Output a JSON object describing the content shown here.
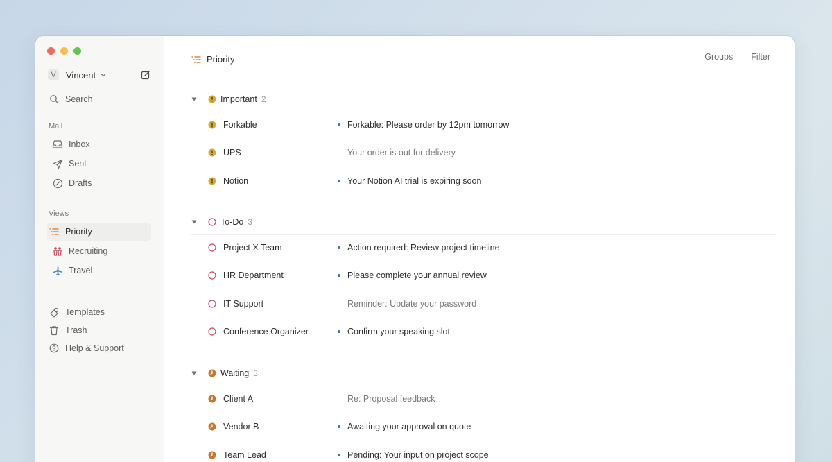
{
  "account": {
    "initial": "V",
    "name": "Vincent"
  },
  "sidebar": {
    "search": "Search",
    "mail_section": "Mail",
    "mail_items": [
      "Inbox",
      "Sent",
      "Drafts"
    ],
    "views_section": "Views",
    "view_items": [
      "Priority",
      "Recruiting",
      "Travel"
    ],
    "bottom_items": [
      "Templates",
      "Trash",
      "Help & Support"
    ]
  },
  "header": {
    "title": "Priority",
    "groups": "Groups",
    "filter": "Filter"
  },
  "groups": [
    {
      "label": "Important",
      "count": "2",
      "icon": "exclamation-icon",
      "color": "#d9a93a",
      "rows": [
        {
          "sender": "Forkable",
          "subject": "Forkable: Please order by 12pm tomorrow",
          "unread": true
        },
        {
          "sender": "UPS",
          "subject": "Your order is out for delivery",
          "unread": false
        },
        {
          "sender": "Notion",
          "subject": "Your Notion AI trial is expiring soon",
          "unread": true
        }
      ]
    },
    {
      "label": "To-Do",
      "count": "3",
      "icon": "circle-icon",
      "color": "#c7485b",
      "rows": [
        {
          "sender": "Project X Team",
          "subject": "Action required: Review project timeline",
          "unread": true
        },
        {
          "sender": "HR Department",
          "subject": "Please complete your annual review",
          "unread": true
        },
        {
          "sender": "IT Support",
          "subject": "Reminder: Update your password",
          "unread": false
        },
        {
          "sender": "Conference Organizer",
          "subject": "Confirm your speaking slot",
          "unread": true
        }
      ]
    },
    {
      "label": "Waiting",
      "count": "3",
      "icon": "clock-icon",
      "color": "#c7762f",
      "rows": [
        {
          "sender": "Client A",
          "subject": "Re: Proposal feedback",
          "unread": false
        },
        {
          "sender": "Vendor B",
          "subject": "Awaiting your approval on quote",
          "unread": true
        },
        {
          "sender": "Team Lead",
          "subject": "Pending: Your input on project scope",
          "unread": true
        }
      ]
    }
  ],
  "colors": {
    "accent_blue": "#2f74c0",
    "priority_orange": "#d98a4a"
  }
}
